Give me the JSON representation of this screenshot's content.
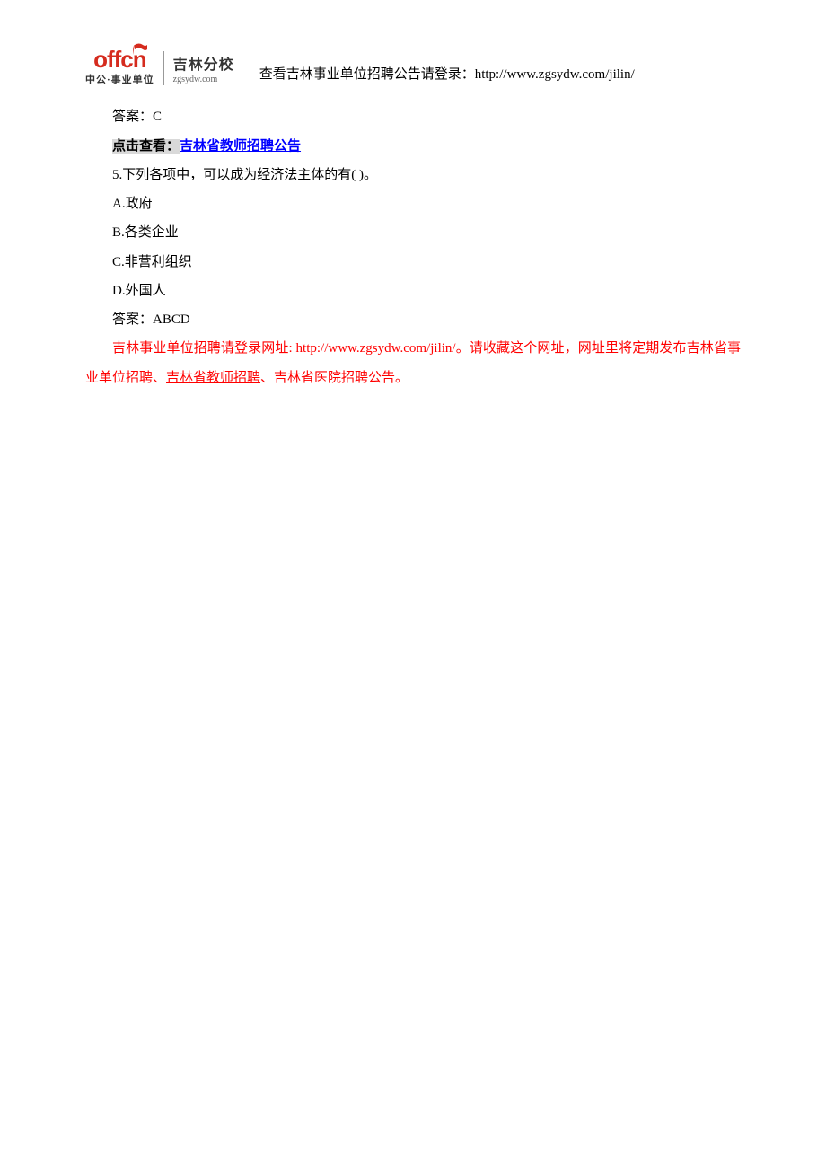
{
  "header": {
    "logo": {
      "main": "offcn",
      "sub": "中公·事业单位",
      "branch": "吉林分校",
      "domain": "zgsydw.com"
    },
    "note": "查看吉林事业单位招聘公告请登录：http://www.zgsydw.com/jilin/"
  },
  "content": {
    "answer4": "答案：C",
    "clickPrompt": "点击查看：",
    "clickLink": "吉林省教师招聘公告",
    "question5": "5.下列各项中，可以成为经济法主体的有( )。",
    "optA": "A.政府",
    "optB": "B.各类企业",
    "optC": "C.非营利组织",
    "optD": "D.外国人",
    "answer5": "答案：ABCD",
    "footer1": "吉林事业单位招聘请登录网址: http://www.zgsydw.com/jilin/。请收藏这个网址，网址里将定期发布吉林省事业单位招聘、",
    "footer2": "吉林省教师招聘",
    "footer3": "、吉林省医院招聘公告。"
  }
}
